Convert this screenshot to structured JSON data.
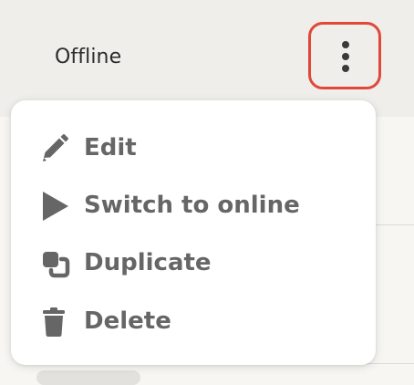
{
  "row": {
    "status": "Offline",
    "more_button_icon": "more-vertical-icon"
  },
  "menu": {
    "items": [
      {
        "label": "Edit",
        "icon": "pencil-icon"
      },
      {
        "label": "Switch to online",
        "icon": "play-icon"
      },
      {
        "label": "Duplicate",
        "icon": "duplicate-icon"
      },
      {
        "label": "Delete",
        "icon": "trash-icon"
      }
    ]
  },
  "colors": {
    "highlight": "#e0483a",
    "menu_text": "#666666",
    "background": "#efeeea"
  }
}
